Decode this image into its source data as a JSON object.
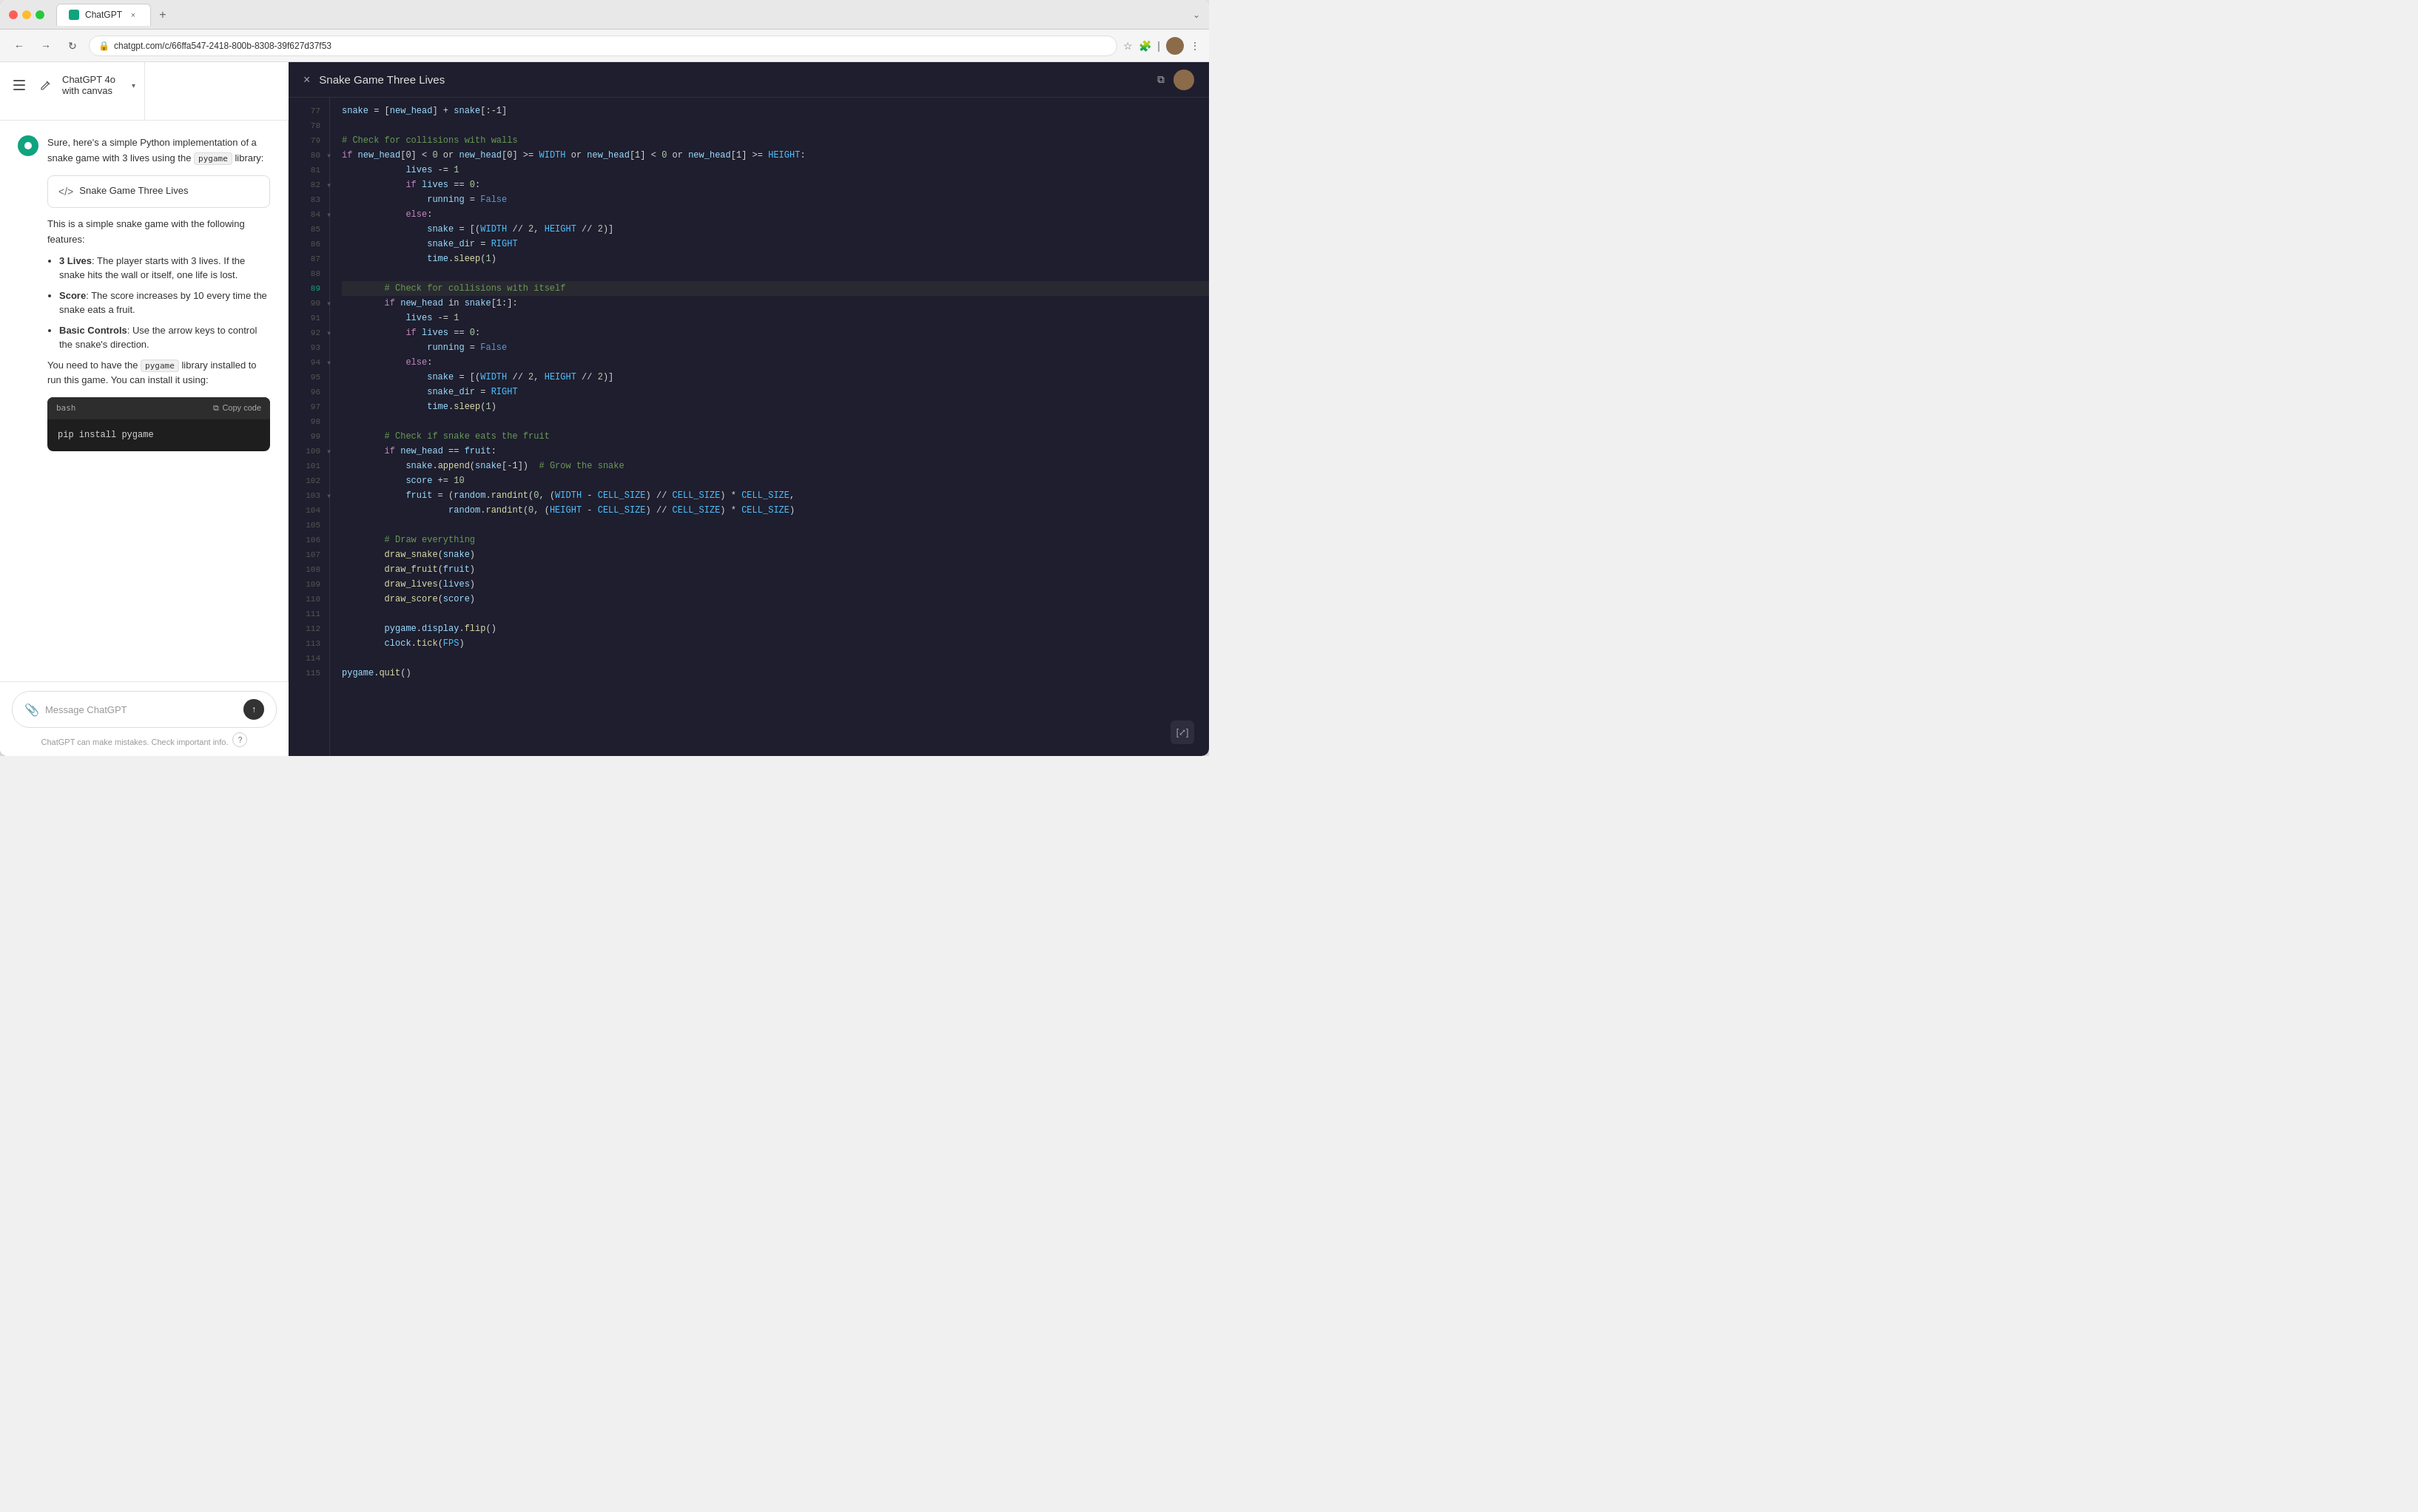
{
  "browser": {
    "tab_title": "ChatGPT",
    "tab_icon": "chatgpt-icon",
    "url": "chatgpt.com/c/66ffa547-2418-800b-8308-39f627d37f53",
    "new_tab_label": "+"
  },
  "sidebar": {
    "app_title": "ChatGPT 4o with canvas",
    "arrow": "▾"
  },
  "chat": {
    "intro_text": "Sure, here's a simple Python implementation of a snake game with 3 lives using the",
    "pygame_inline": "pygame",
    "library_text": "library:",
    "canvas_button": "Snake Game Three Lives",
    "description": "This is a simple snake game with the following features:",
    "bullets": [
      {
        "bold": "3 Lives",
        "text": ": The player starts with 3 lives. If the snake hits the wall or itself, one life is lost."
      },
      {
        "bold": "Score",
        "text": ": The score increases by 10 every time the snake eats a fruit."
      },
      {
        "bold": "Basic Controls",
        "text": ": Use the arrow keys to control the snake's direction."
      }
    ],
    "pygame_note_pre": "You need to have the",
    "pygame_note_inline": "pygame",
    "pygame_note_post": "library installed to run this game. You can install it using:",
    "code_block": {
      "lang": "bash",
      "copy_label": "Copy code",
      "code": "pip install pygame"
    }
  },
  "input": {
    "placeholder": "Message ChatGPT",
    "disclaimer": "ChatGPT can make mistakes. Check important info."
  },
  "panel": {
    "title": "Snake Game Three Lives",
    "close_label": "×",
    "copy_label": "⧉"
  },
  "code_lines": [
    {
      "num": 77,
      "active": false,
      "collapse": false,
      "tokens": [
        [
          "var",
          "snake"
        ],
        [
          "op",
          " = ["
        ],
        [
          "var",
          "new_head"
        ],
        [
          "op",
          "] + "
        ],
        [
          "var",
          "snake"
        ],
        [
          "op",
          "[:-1]"
        ]
      ]
    },
    {
      "num": 78,
      "active": false,
      "collapse": false,
      "tokens": [
        [
          "plain",
          ""
        ]
      ]
    },
    {
      "num": 79,
      "active": false,
      "collapse": false,
      "tokens": [
        [
          "cm",
          "# Check for collisions with walls"
        ]
      ]
    },
    {
      "num": 80,
      "active": false,
      "collapse": true,
      "tokens": [
        [
          "kw",
          "if "
        ],
        [
          "var",
          "new_head"
        ],
        [
          "op",
          "[0] < "
        ],
        [
          "num",
          "0"
        ],
        [
          "op",
          " or "
        ],
        [
          "var",
          "new_head"
        ],
        [
          "op",
          "[0] >= "
        ],
        [
          "const",
          "WIDTH"
        ],
        [
          "op",
          " or "
        ],
        [
          "var",
          "new_head"
        ],
        [
          "op",
          "[1] < "
        ],
        [
          "num",
          "0"
        ],
        [
          "op",
          " or "
        ],
        [
          "var",
          "new_head"
        ],
        [
          "op",
          "[1] >= "
        ],
        [
          "const",
          "HEIGHT"
        ],
        [
          "op",
          ":"
        ]
      ]
    },
    {
      "num": 81,
      "active": false,
      "collapse": false,
      "tokens": [
        [
          "var",
          "            lives"
        ],
        [
          "op",
          " -= "
        ],
        [
          "num",
          "1"
        ]
      ]
    },
    {
      "num": 82,
      "active": false,
      "collapse": true,
      "tokens": [
        [
          "kw",
          "            if "
        ],
        [
          "var",
          "lives"
        ],
        [
          "op",
          " == "
        ],
        [
          "num",
          "0"
        ],
        [
          "op",
          ":"
        ]
      ]
    },
    {
      "num": 83,
      "active": false,
      "collapse": false,
      "tokens": [
        [
          "var",
          "                running"
        ],
        [
          "op",
          " = "
        ],
        [
          "bool",
          "False"
        ]
      ]
    },
    {
      "num": 84,
      "active": false,
      "collapse": true,
      "tokens": [
        [
          "kw",
          "            else"
        ],
        [
          "op",
          ":"
        ]
      ]
    },
    {
      "num": 85,
      "active": false,
      "collapse": false,
      "tokens": [
        [
          "var",
          "                snake"
        ],
        [
          "op",
          " = [("
        ],
        [
          "const",
          "WIDTH"
        ],
        [
          "op",
          " // "
        ],
        [
          "num",
          "2"
        ],
        [
          "op",
          ", "
        ],
        [
          "const",
          "HEIGHT"
        ],
        [
          "op",
          " // "
        ],
        [
          "num",
          "2"
        ],
        [
          "op",
          ")]"
        ]
      ]
    },
    {
      "num": 86,
      "active": false,
      "collapse": false,
      "tokens": [
        [
          "var",
          "                snake_dir"
        ],
        [
          "op",
          " = "
        ],
        [
          "const",
          "RIGHT"
        ]
      ]
    },
    {
      "num": 87,
      "active": false,
      "collapse": false,
      "tokens": [
        [
          "var",
          "                time"
        ],
        [
          "op",
          "."
        ],
        [
          "fn",
          "sleep"
        ],
        [
          "op",
          "("
        ],
        [
          "num",
          "1"
        ],
        [
          "op",
          ")"
        ]
      ]
    },
    {
      "num": 88,
      "active": false,
      "collapse": false,
      "tokens": [
        [
          "plain",
          ""
        ]
      ]
    },
    {
      "num": 89,
      "active": true,
      "collapse": false,
      "tokens": [
        [
          "cm",
          "        # Check for collisions with itself"
        ]
      ]
    },
    {
      "num": 90,
      "active": false,
      "collapse": true,
      "tokens": [
        [
          "kw",
          "        if "
        ],
        [
          "var",
          "new_head"
        ],
        [
          "op",
          " in "
        ],
        [
          "var",
          "snake"
        ],
        [
          "op",
          "[1:]:"
        ]
      ]
    },
    {
      "num": 91,
      "active": false,
      "collapse": false,
      "tokens": [
        [
          "var",
          "            lives"
        ],
        [
          "op",
          " -= "
        ],
        [
          "num",
          "1"
        ]
      ]
    },
    {
      "num": 92,
      "active": false,
      "collapse": true,
      "tokens": [
        [
          "kw",
          "            if "
        ],
        [
          "var",
          "lives"
        ],
        [
          "op",
          " == "
        ],
        [
          "num",
          "0"
        ],
        [
          "op",
          ":"
        ]
      ]
    },
    {
      "num": 93,
      "active": false,
      "collapse": false,
      "tokens": [
        [
          "var",
          "                running"
        ],
        [
          "op",
          " = "
        ],
        [
          "bool",
          "False"
        ]
      ]
    },
    {
      "num": 94,
      "active": false,
      "collapse": true,
      "tokens": [
        [
          "kw",
          "            else"
        ],
        [
          "op",
          ":"
        ]
      ]
    },
    {
      "num": 95,
      "active": false,
      "collapse": false,
      "tokens": [
        [
          "var",
          "                snake"
        ],
        [
          "op",
          " = [("
        ],
        [
          "const",
          "WIDTH"
        ],
        [
          "op",
          " // "
        ],
        [
          "num",
          "2"
        ],
        [
          "op",
          ", "
        ],
        [
          "const",
          "HEIGHT"
        ],
        [
          "op",
          " // "
        ],
        [
          "num",
          "2"
        ],
        [
          "op",
          ")]"
        ]
      ]
    },
    {
      "num": 96,
      "active": false,
      "collapse": false,
      "tokens": [
        [
          "var",
          "                snake_dir"
        ],
        [
          "op",
          " = "
        ],
        [
          "const",
          "RIGHT"
        ]
      ]
    },
    {
      "num": 97,
      "active": false,
      "collapse": false,
      "tokens": [
        [
          "var",
          "                time"
        ],
        [
          "op",
          "."
        ],
        [
          "fn",
          "sleep"
        ],
        [
          "op",
          "("
        ],
        [
          "num",
          "1"
        ],
        [
          "op",
          ")"
        ]
      ]
    },
    {
      "num": 98,
      "active": false,
      "collapse": false,
      "tokens": [
        [
          "plain",
          ""
        ]
      ]
    },
    {
      "num": 99,
      "active": false,
      "collapse": false,
      "tokens": [
        [
          "cm",
          "        # Check if snake eats the fruit"
        ]
      ]
    },
    {
      "num": 100,
      "active": false,
      "collapse": true,
      "tokens": [
        [
          "kw",
          "        if "
        ],
        [
          "var",
          "new_head"
        ],
        [
          "op",
          " == "
        ],
        [
          "var",
          "fruit"
        ],
        [
          "op",
          ":"
        ]
      ]
    },
    {
      "num": 101,
      "active": false,
      "collapse": false,
      "tokens": [
        [
          "var",
          "            snake"
        ],
        [
          "op",
          "."
        ],
        [
          "fn",
          "append"
        ],
        [
          "op",
          "("
        ],
        [
          "var",
          "snake"
        ],
        [
          "op",
          "[-1])  "
        ],
        [
          "cm",
          "# Grow the snake"
        ]
      ]
    },
    {
      "num": 102,
      "active": false,
      "collapse": false,
      "tokens": [
        [
          "var",
          "            score"
        ],
        [
          "op",
          " += "
        ],
        [
          "num",
          "10"
        ]
      ]
    },
    {
      "num": 103,
      "active": false,
      "collapse": true,
      "tokens": [
        [
          "var",
          "            fruit"
        ],
        [
          "op",
          " = ("
        ],
        [
          "var",
          "random"
        ],
        [
          "op",
          "."
        ],
        [
          "fn",
          "randint"
        ],
        [
          "op",
          "("
        ],
        [
          "num",
          "0"
        ],
        [
          "op",
          ", ("
        ],
        [
          "const",
          "WIDTH"
        ],
        [
          "op",
          " - "
        ],
        [
          "const",
          "CELL_SIZE"
        ],
        [
          "op",
          ") // "
        ],
        [
          "const",
          "CELL_SIZE"
        ],
        [
          "op",
          ") * "
        ],
        [
          "const",
          "CELL_SIZE"
        ],
        [
          "op",
          ","
        ]
      ]
    },
    {
      "num": 104,
      "active": false,
      "collapse": false,
      "tokens": [
        [
          "op",
          "                    "
        ],
        [
          "var",
          "random"
        ],
        [
          "op",
          "."
        ],
        [
          "fn",
          "randint"
        ],
        [
          "op",
          "("
        ],
        [
          "num",
          "0"
        ],
        [
          "op",
          ", ("
        ],
        [
          "const",
          "HEIGHT"
        ],
        [
          "op",
          " - "
        ],
        [
          "const",
          "CELL_SIZE"
        ],
        [
          "op",
          ") // "
        ],
        [
          "const",
          "CELL_SIZE"
        ],
        [
          "op",
          ") * "
        ],
        [
          "const",
          "CELL_SIZE"
        ],
        [
          "op",
          ")"
        ]
      ]
    },
    {
      "num": 105,
      "active": false,
      "collapse": false,
      "tokens": [
        [
          "plain",
          ""
        ]
      ]
    },
    {
      "num": 106,
      "active": false,
      "collapse": false,
      "tokens": [
        [
          "cm",
          "        # Draw everything"
        ]
      ]
    },
    {
      "num": 107,
      "active": false,
      "collapse": false,
      "tokens": [
        [
          "fn",
          "        draw_snake"
        ],
        [
          "op",
          "("
        ],
        [
          "var",
          "snake"
        ],
        [
          "op",
          ")"
        ]
      ]
    },
    {
      "num": 108,
      "active": false,
      "collapse": false,
      "tokens": [
        [
          "fn",
          "        draw_fruit"
        ],
        [
          "op",
          "("
        ],
        [
          "var",
          "fruit"
        ],
        [
          "op",
          ")"
        ]
      ]
    },
    {
      "num": 109,
      "active": false,
      "collapse": false,
      "tokens": [
        [
          "fn",
          "        draw_lives"
        ],
        [
          "op",
          "("
        ],
        [
          "var",
          "lives"
        ],
        [
          "op",
          ")"
        ]
      ]
    },
    {
      "num": 110,
      "active": false,
      "collapse": false,
      "tokens": [
        [
          "fn",
          "        draw_score"
        ],
        [
          "op",
          "("
        ],
        [
          "var",
          "score"
        ],
        [
          "op",
          ")"
        ]
      ]
    },
    {
      "num": 111,
      "active": false,
      "collapse": false,
      "tokens": [
        [
          "plain",
          ""
        ]
      ]
    },
    {
      "num": 112,
      "active": false,
      "collapse": false,
      "tokens": [
        [
          "var",
          "        pygame"
        ],
        [
          "op",
          "."
        ],
        [
          "var",
          "display"
        ],
        [
          "op",
          "."
        ],
        [
          "fn",
          "flip"
        ],
        [
          "op",
          "()"
        ]
      ]
    },
    {
      "num": 113,
      "active": false,
      "collapse": false,
      "tokens": [
        [
          "var",
          "        clock"
        ],
        [
          "op",
          "."
        ],
        [
          "fn",
          "tick"
        ],
        [
          "op",
          "("
        ],
        [
          "const",
          "FPS"
        ],
        [
          "op",
          ")"
        ]
      ]
    },
    {
      "num": 114,
      "active": false,
      "collapse": false,
      "tokens": [
        [
          "plain",
          ""
        ]
      ]
    },
    {
      "num": 115,
      "active": false,
      "collapse": false,
      "tokens": [
        [
          "var",
          "pygame"
        ],
        [
          "op",
          "."
        ],
        [
          "fn",
          "quit"
        ],
        [
          "op",
          "()"
        ]
      ]
    }
  ]
}
